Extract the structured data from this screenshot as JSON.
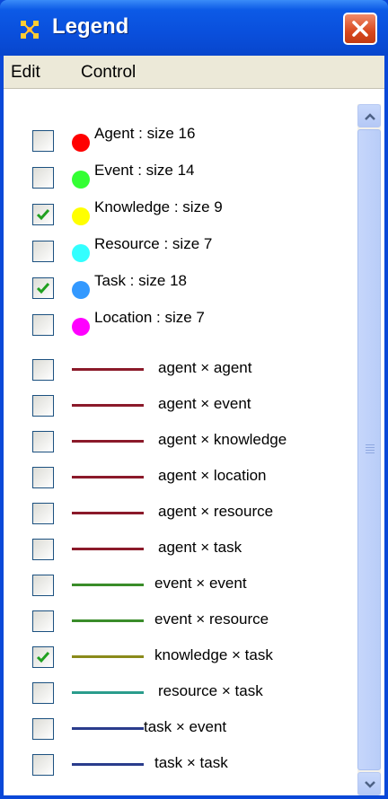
{
  "window": {
    "title": "Legend",
    "icon": "app-grid-icon",
    "close_icon": "close-icon"
  },
  "menu": {
    "items": [
      {
        "label": "Edit"
      },
      {
        "label": "Control"
      }
    ]
  },
  "colors": {
    "title_bar": "#0a4fdc",
    "node_agent": "#ff0000",
    "node_event": "#33ff33",
    "node_knowledge": "#ffff00",
    "node_resource": "#33ffff",
    "node_task": "#3399ff",
    "node_location": "#ff00ff",
    "edge_agent": "#8b1a2a",
    "edge_event": "#3a8c2a",
    "edge_knowledge": "#8a8a1a",
    "edge_resource": "#2a9c8c",
    "edge_task": "#2a3c8c",
    "check": "#20a020"
  },
  "nodes": [
    {
      "label": "Agent : size 16",
      "checked": false
    },
    {
      "label": "Event : size 14",
      "checked": false
    },
    {
      "label": "Knowledge : size 9",
      "checked": true
    },
    {
      "label": "Resource : size 7",
      "checked": false
    },
    {
      "label": "Task : size 18",
      "checked": true
    },
    {
      "label": "Location : size 7",
      "checked": false
    }
  ],
  "edges": [
    {
      "label": "agent × agent",
      "checked": false
    },
    {
      "label": "agent × event",
      "checked": false
    },
    {
      "label": "agent × knowledge",
      "checked": false
    },
    {
      "label": "agent × location",
      "checked": false
    },
    {
      "label": "agent × resource",
      "checked": false
    },
    {
      "label": "agent × task",
      "checked": false
    },
    {
      "label": "event × event",
      "checked": false
    },
    {
      "label": "event × resource",
      "checked": false
    },
    {
      "label": "knowledge × task",
      "checked": true
    },
    {
      "label": "resource × task",
      "checked": false
    },
    {
      "label": "task × event",
      "checked": false
    },
    {
      "label": "task × task",
      "checked": false
    }
  ],
  "scrollbar": {
    "up_icon": "chevron-up-icon",
    "down_icon": "chevron-down-icon",
    "position": 0.0
  }
}
